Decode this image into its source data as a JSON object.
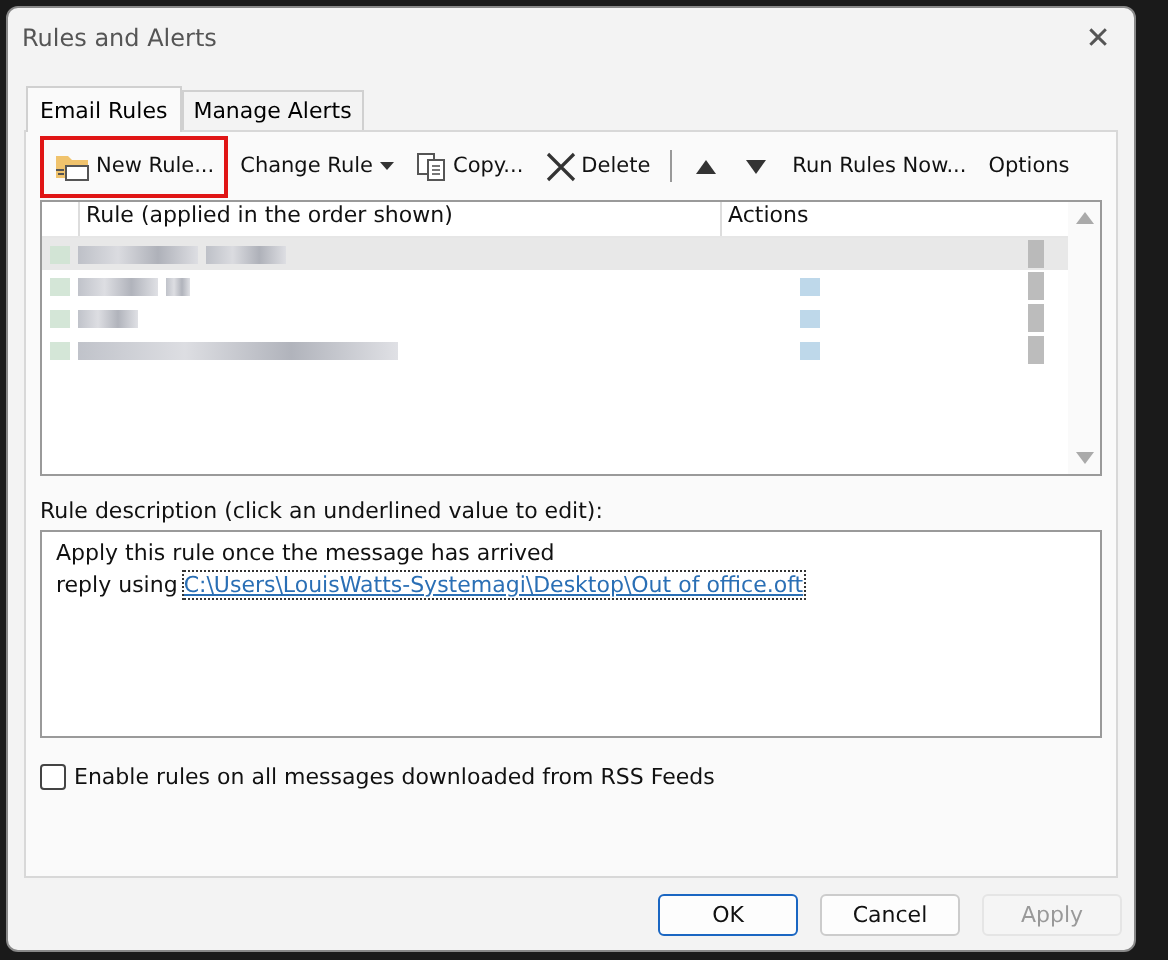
{
  "window": {
    "title": "Rules and Alerts",
    "close": "✕"
  },
  "tabs": [
    {
      "label": "Email Rules",
      "selected": true
    },
    {
      "label": "Manage Alerts",
      "selected": false
    }
  ],
  "toolbar": [
    {
      "kind": "new",
      "label": "New Rule...",
      "highlighted": true
    },
    {
      "kind": "dropdown",
      "label": "Change Rule",
      "highlighted": false
    },
    {
      "kind": "copy",
      "label": "Copy...",
      "highlighted": false
    },
    {
      "kind": "delete",
      "label": "Delete",
      "highlighted": false
    },
    {
      "kind": "separator"
    },
    {
      "kind": "up"
    },
    {
      "kind": "down"
    },
    {
      "kind": "text",
      "label": "Run Rules Now...",
      "highlighted": false
    },
    {
      "kind": "text",
      "label": "Options",
      "highlighted": false
    }
  ],
  "table": {
    "columns": [
      "Rule (applied in the order shown)",
      "Actions"
    ],
    "rows": [
      {
        "selected": true
      },
      {
        "selected": false
      },
      {
        "selected": false
      },
      {
        "selected": false
      }
    ]
  },
  "description": {
    "label": "Rule description (click an underlined value to edit):",
    "line_1": "Apply this rule once the message has arrived",
    "line_2_prefix": "reply using",
    "link": "C:\\Users\\LouisWatts-Systemagi\\Desktop\\Out of office.oft"
  },
  "rss_option": {
    "label": "Enable rules on all messages downloaded from RSS Feeds",
    "checked": false
  },
  "buttons": [
    {
      "label": "OK",
      "disabled": false,
      "default": true
    },
    {
      "label": "Cancel",
      "disabled": false,
      "default": false
    },
    {
      "label": "Apply",
      "disabled": true,
      "default": false
    }
  ]
}
